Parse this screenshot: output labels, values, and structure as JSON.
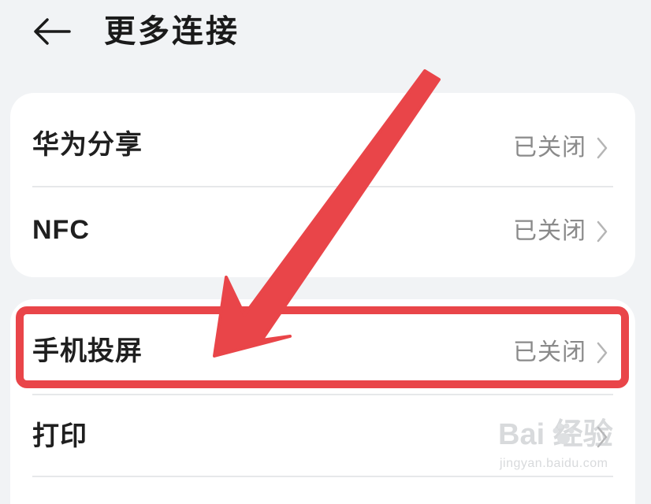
{
  "header": {
    "title": "更多连接",
    "back_icon": "arrow-left-icon"
  },
  "group1": {
    "items": [
      {
        "label": "华为分享",
        "status": "已关闭"
      },
      {
        "label": "NFC",
        "status": "已关闭"
      }
    ]
  },
  "group2": {
    "items": [
      {
        "label": "手机投屏",
        "status": "已关闭"
      },
      {
        "label": "打印",
        "status": ""
      }
    ]
  },
  "annotation": {
    "color": "#e94549",
    "highlighted_item": "手机投屏"
  },
  "watermark": {
    "logo": "Bai 经验",
    "url": "jingyan.baidu.com"
  },
  "colors": {
    "background": "#f1f3f5",
    "card": "#ffffff",
    "status_text": "#8a8a8a",
    "annotation_red": "#e94549"
  }
}
